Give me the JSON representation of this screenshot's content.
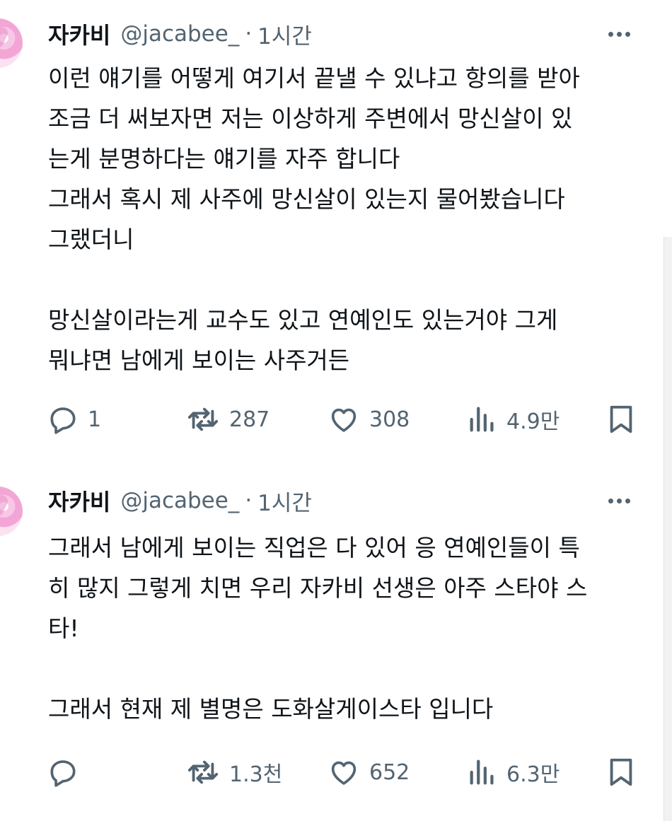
{
  "tweets": [
    {
      "author": {
        "name": "자카비",
        "handle": "@jacabee_",
        "time": "1시간"
      },
      "text": "이런 얘기를 어떻게 여기서 끝낼 수 있냐고 항의를 받아\n조금 더 써보자면 저는 이상하게 주변에서 망신살이 있\n는게 분명하다는 얘기를 자주 합니다\n그래서 혹시 제 사주에 망신살이 있는지 물어봤습니다\n그랬더니\n\n망신살이라는게 교수도 있고 연예인도 있는거야 그게\n뭐냐면 남에게 보이는 사주거든",
      "stats": {
        "replies": "1",
        "retweets": "287",
        "likes": "308",
        "views": "4.9만"
      }
    },
    {
      "author": {
        "name": "자카비",
        "handle": "@jacabee_",
        "time": "1시간"
      },
      "text": "그래서 남에게 보이는 직업은 다 있어 응 연예인들이 특\n히 많지 그렇게 치면 우리 자카비 선생은 아주 스타야 스\n타!\n\n그래서 현재 제 별명은 도화살게이스타 입니다",
      "stats": {
        "replies": "",
        "retweets": "1.3천",
        "likes": "652",
        "views": "6.3만"
      }
    }
  ],
  "separator": "·",
  "icons": [
    "reply-icon",
    "retweet-icon",
    "like-icon",
    "views-icon",
    "bookmark-icon",
    "more-icon"
  ],
  "colors": {
    "text": "#0f1419",
    "secondary": "#536471"
  }
}
